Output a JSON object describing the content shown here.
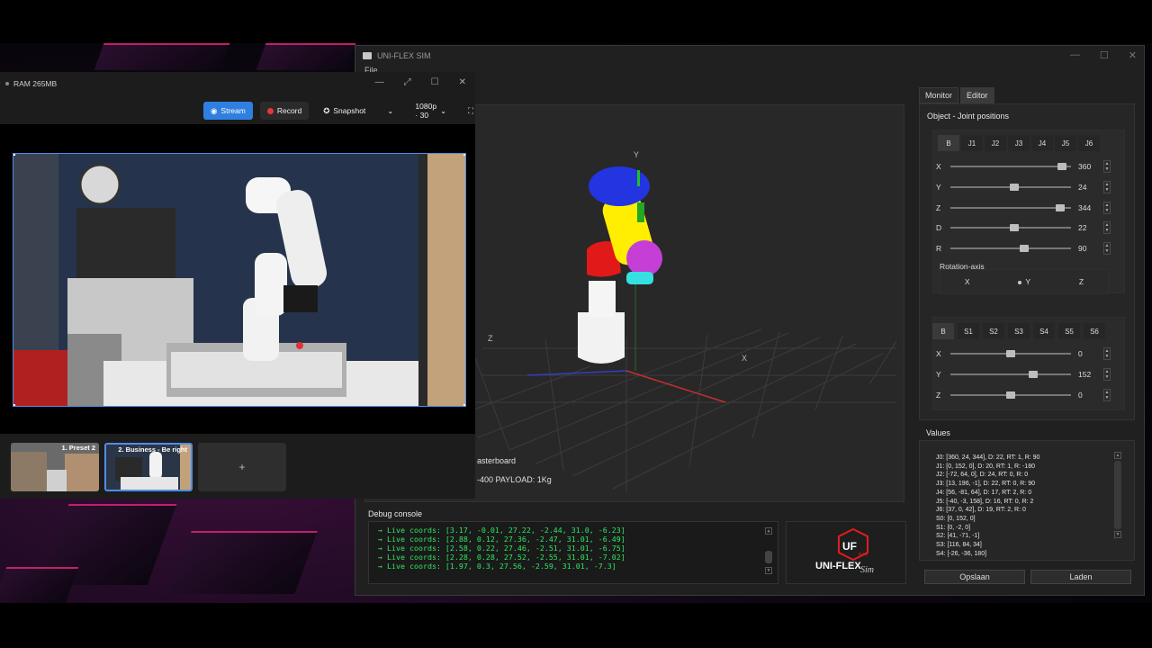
{
  "sim": {
    "title": "UNI-FLEX SIM",
    "menu": "File",
    "window_controls": {
      "min": "—",
      "max": "☐",
      "close": "✕"
    },
    "viewport": {
      "axis_y": "Y",
      "axis_z": "Z",
      "axis_x": "X",
      "label1": "asterboard",
      "label2": "-400 PAYLOAD: 1Kg"
    },
    "debug": {
      "title": "Debug console",
      "lines": [
        "→ Live coords: [3.17, -0.01, 27.22, -2.44, 31.0, -6.23]",
        "→ Live coords: [2.88, 0.12, 27.36, -2.47, 31.01, -6.49]",
        "→ Live coords: [2.58, 0.22, 27.46, -2.51, 31.01, -6.75]",
        "→ Live coords: [2.28, 0.28, 27.52, -2.55, 31.01, -7.02]",
        "→ Live coords: [1.97, 0.3, 27.56, -2.59, 31.01, -7.3]"
      ]
    },
    "logo": {
      "mark": "UF",
      "badge": "FLEX",
      "text": "UNI-FLEX",
      "sim": "Sim"
    },
    "tabs": [
      {
        "label": "Monitor"
      },
      {
        "label": "Editor"
      }
    ],
    "panel_title": "Object - Joint positions",
    "joint_buttons": [
      "B",
      "J1",
      "J2",
      "J3",
      "J4",
      "J5",
      "J6"
    ],
    "joint_sliders": [
      {
        "label": "X",
        "value": "360",
        "level": 0.96
      },
      {
        "label": "Y",
        "value": "24",
        "level": 0.53
      },
      {
        "label": "Z",
        "value": "344",
        "level": 0.94
      },
      {
        "label": "D",
        "value": "22",
        "level": 0.53
      },
      {
        "label": "R",
        "value": "90",
        "level": 0.62
      }
    ],
    "rotation_axis": {
      "label": "Rotation-axis",
      "options": [
        "X",
        "Y",
        "Z"
      ],
      "selected": "Y"
    },
    "servo_buttons": [
      "B",
      "S1",
      "S2",
      "S3",
      "S4",
      "S5",
      "S6"
    ],
    "servo_sliders": [
      {
        "label": "X",
        "value": "0",
        "level": 0.5
      },
      {
        "label": "Y",
        "value": "152",
        "level": 0.7
      },
      {
        "label": "Z",
        "value": "0",
        "level": 0.5
      }
    ],
    "values_title": "Values",
    "values": [
      "J0: [360, 24, 344], D: 22, RT: 1, R: 90",
      "J1: [0, 152, 0], D: 20, RT: 1, R: -180",
      "J2: [-72, 64, 0], D: 24, RT: 0, R: 0",
      "J3: [13, 196, -1], D: 22, RT: 0, R: 90",
      "J4: [56, -81, 64], D: 17, RT: 2, R: 0",
      "J5: [-40, -3, 158], D: 16, RT: 0, R: 2",
      "J6: [37, 0, 42], D: 19, RT: 2, R: 0",
      "S0: [0, 152, 0]",
      "S1: [0, -2, 0]",
      "S2: [41, -71, -1]",
      "S3: [116, 84, 34]",
      "S4: [-26, -36, 180]"
    ],
    "save_label": "Opslaan",
    "load_label": "Laden"
  },
  "cam": {
    "title": "RAM 265MB",
    "window_controls": {
      "min": "—",
      "restore": "⤢",
      "max": "☐",
      "close": "✕"
    },
    "stream_label": "Stream",
    "record_label": "Record",
    "snapshot_label": "Snapshot",
    "quality_label": "1080p · 30",
    "fullscreen_icon": "⛶",
    "thumbs": [
      {
        "caption": "1. Preset 2"
      },
      {
        "caption": "2. Business - Be right"
      }
    ],
    "add_label": "+"
  },
  "colors": {
    "accent": "#2f7fe0",
    "console_text": "#2ee85e",
    "record": "#e53935"
  }
}
